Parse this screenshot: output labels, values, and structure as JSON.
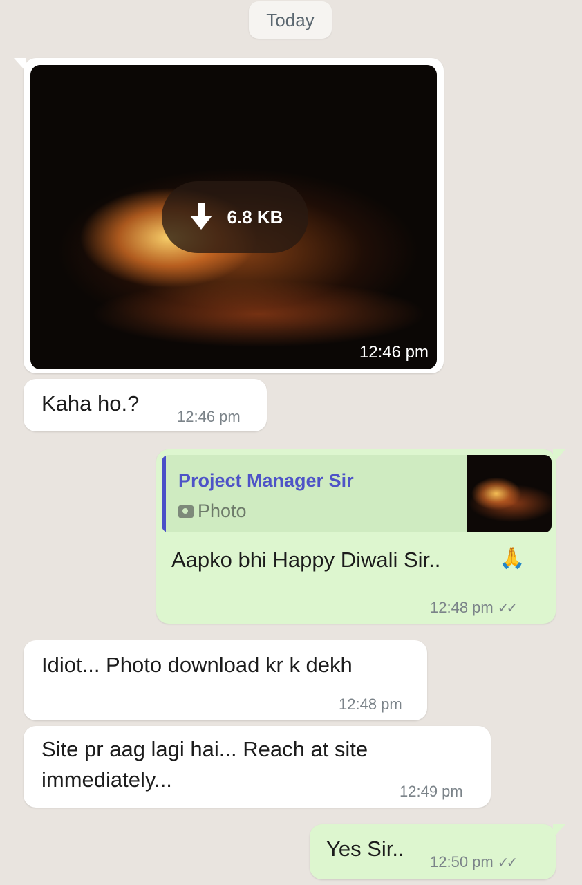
{
  "date_chip": "Today",
  "messages": {
    "photo": {
      "size": "6.8 KB",
      "time": "12:46 pm",
      "icon": "download-icon"
    },
    "m1": {
      "text": "Kaha ho.?",
      "time": "12:46 pm"
    },
    "m2": {
      "reply_to_name": "Project Manager Sir",
      "reply_to_type": "Photo",
      "text": "Aapko bhi Happy Diwali Sir..",
      "emoji": "🙏",
      "time": "12:48 pm"
    },
    "m3": {
      "text": "Idiot... Photo download kr k dekh",
      "time": "12:48 pm"
    },
    "m4": {
      "line1": "Site pr aag lagi hai... Reach at site",
      "line2": "immediately...",
      "time": "12:49 pm"
    },
    "m5": {
      "text": "Yes Sir..",
      "time": "12:50 pm"
    }
  },
  "colors": {
    "incoming": "#ffffff",
    "outgoing": "#ddf6cf",
    "quote_name": "#4e53c7",
    "background": "#e9e4df"
  }
}
